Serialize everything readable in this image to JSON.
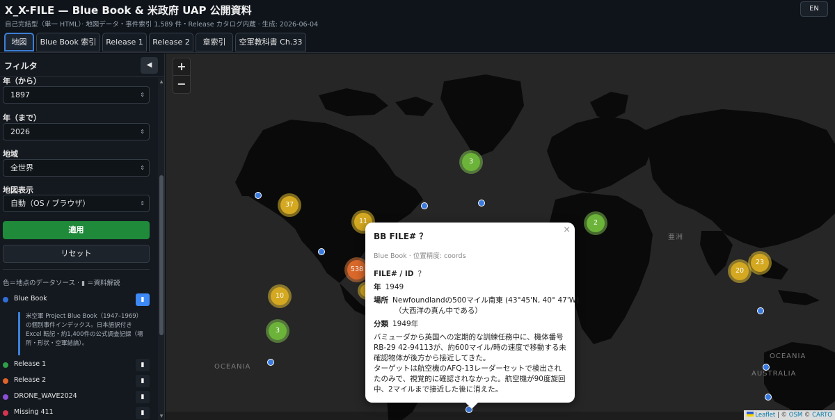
{
  "header": {
    "title": "X_X-FILE — Blue Book & 米政府 UAP 公開資料",
    "subtitle": "自己完結型（単一 HTML）· 地図データ・事件索引 1,589 件・Release カタログ内蔵 · 生成: 2026-06-04",
    "lang_label": "EN"
  },
  "tabs": [
    {
      "label": "地図",
      "active": true
    },
    {
      "label": "Blue Book 索引",
      "active": false
    },
    {
      "label": "Release 1",
      "active": false
    },
    {
      "label": "Release 2",
      "active": false
    },
    {
      "label": "章索引",
      "active": false
    },
    {
      "label": "空軍教科書 Ch.33",
      "active": false
    }
  ],
  "sidebar": {
    "title": "フィルタ",
    "collapse_icon": "◀",
    "year_from_label": "年（から）",
    "year_from_value": "1897",
    "year_to_label": "年（まで）",
    "year_to_value": "2026",
    "region_label": "地域",
    "region_value": "全世界",
    "map_display_label": "地図表示",
    "map_display_value": "自動（OS / ブラウザ）",
    "apply_label": "適用",
    "reset_label": "リセット",
    "legend_note_prefix": "色＝地点のデータソース ·",
    "legend_note_suffix": "＝資料解説",
    "sources": [
      {
        "label": "Blue Book",
        "color": "#2f6fd6",
        "bookmark_active": true
      },
      {
        "label": "Release 1",
        "color": "#2e9e48",
        "bookmark_active": false
      },
      {
        "label": "Release 2",
        "color": "#e0642a",
        "bookmark_active": false
      },
      {
        "label": "DRONE_WAVE2024",
        "color": "#8a4fd6",
        "bookmark_active": false
      },
      {
        "label": "Missing 411",
        "color": "#d6334f",
        "bookmark_active": false
      }
    ],
    "bluebook_desc": "米空軍 Project Blue Book（1947–1969）の個別事件インデックス。日本語訳付き Excel 転記・約1,400件の公式調査記録（場所・形状・空軍結論）。"
  },
  "map": {
    "zoom_in": "+",
    "zoom_out": "−",
    "labels": {
      "ocean_left": "OCEANIA",
      "ocean_right": "OCEANIA",
      "australia": "AUSTRALIA",
      "asia": "亜洲"
    },
    "clusters": [
      {
        "count": "3",
        "color": "green"
      },
      {
        "count": "37",
        "color": "yellow"
      },
      {
        "count": "11",
        "color": "yellow"
      },
      {
        "count": "2",
        "color": "green"
      },
      {
        "count": "538",
        "color": "orange"
      },
      {
        "count": "10",
        "color": "yellow"
      },
      {
        "count": "3",
        "color": "green"
      },
      {
        "count": "20",
        "color": "yellow"
      },
      {
        "count": "23",
        "color": "yellow"
      }
    ],
    "attribution": {
      "leaflet": "Leaflet",
      "osm": "OSM",
      "carto": "CARTO"
    }
  },
  "popup": {
    "title": "BB FILE# ？",
    "meta": "Blue Book · 位置精度: coords",
    "fields": [
      {
        "label": "FILE# / ID",
        "value": "？"
      },
      {
        "label": "年",
        "value": "1949"
      },
      {
        "label": "場所",
        "value": "Newfoundlandの500マイル南東 (43°45'N, 40° 47'W)",
        "value2": "（大西洋の真ん中である）"
      },
      {
        "label": "分類",
        "value": "1949年"
      }
    ],
    "body": "バミューダから英国への定期的な訓練任務中に、機体番号RB-29 42-94113が、約600マイル/時の速度で移動する未確認物体が後方から接近してきた。\nターゲットは航空機のAFQ-13レーダーセットで検出されたのみで、視覚的に確認されなかった。航空機が90度旋回中、2マイルまで接近した後に消えた。"
  }
}
